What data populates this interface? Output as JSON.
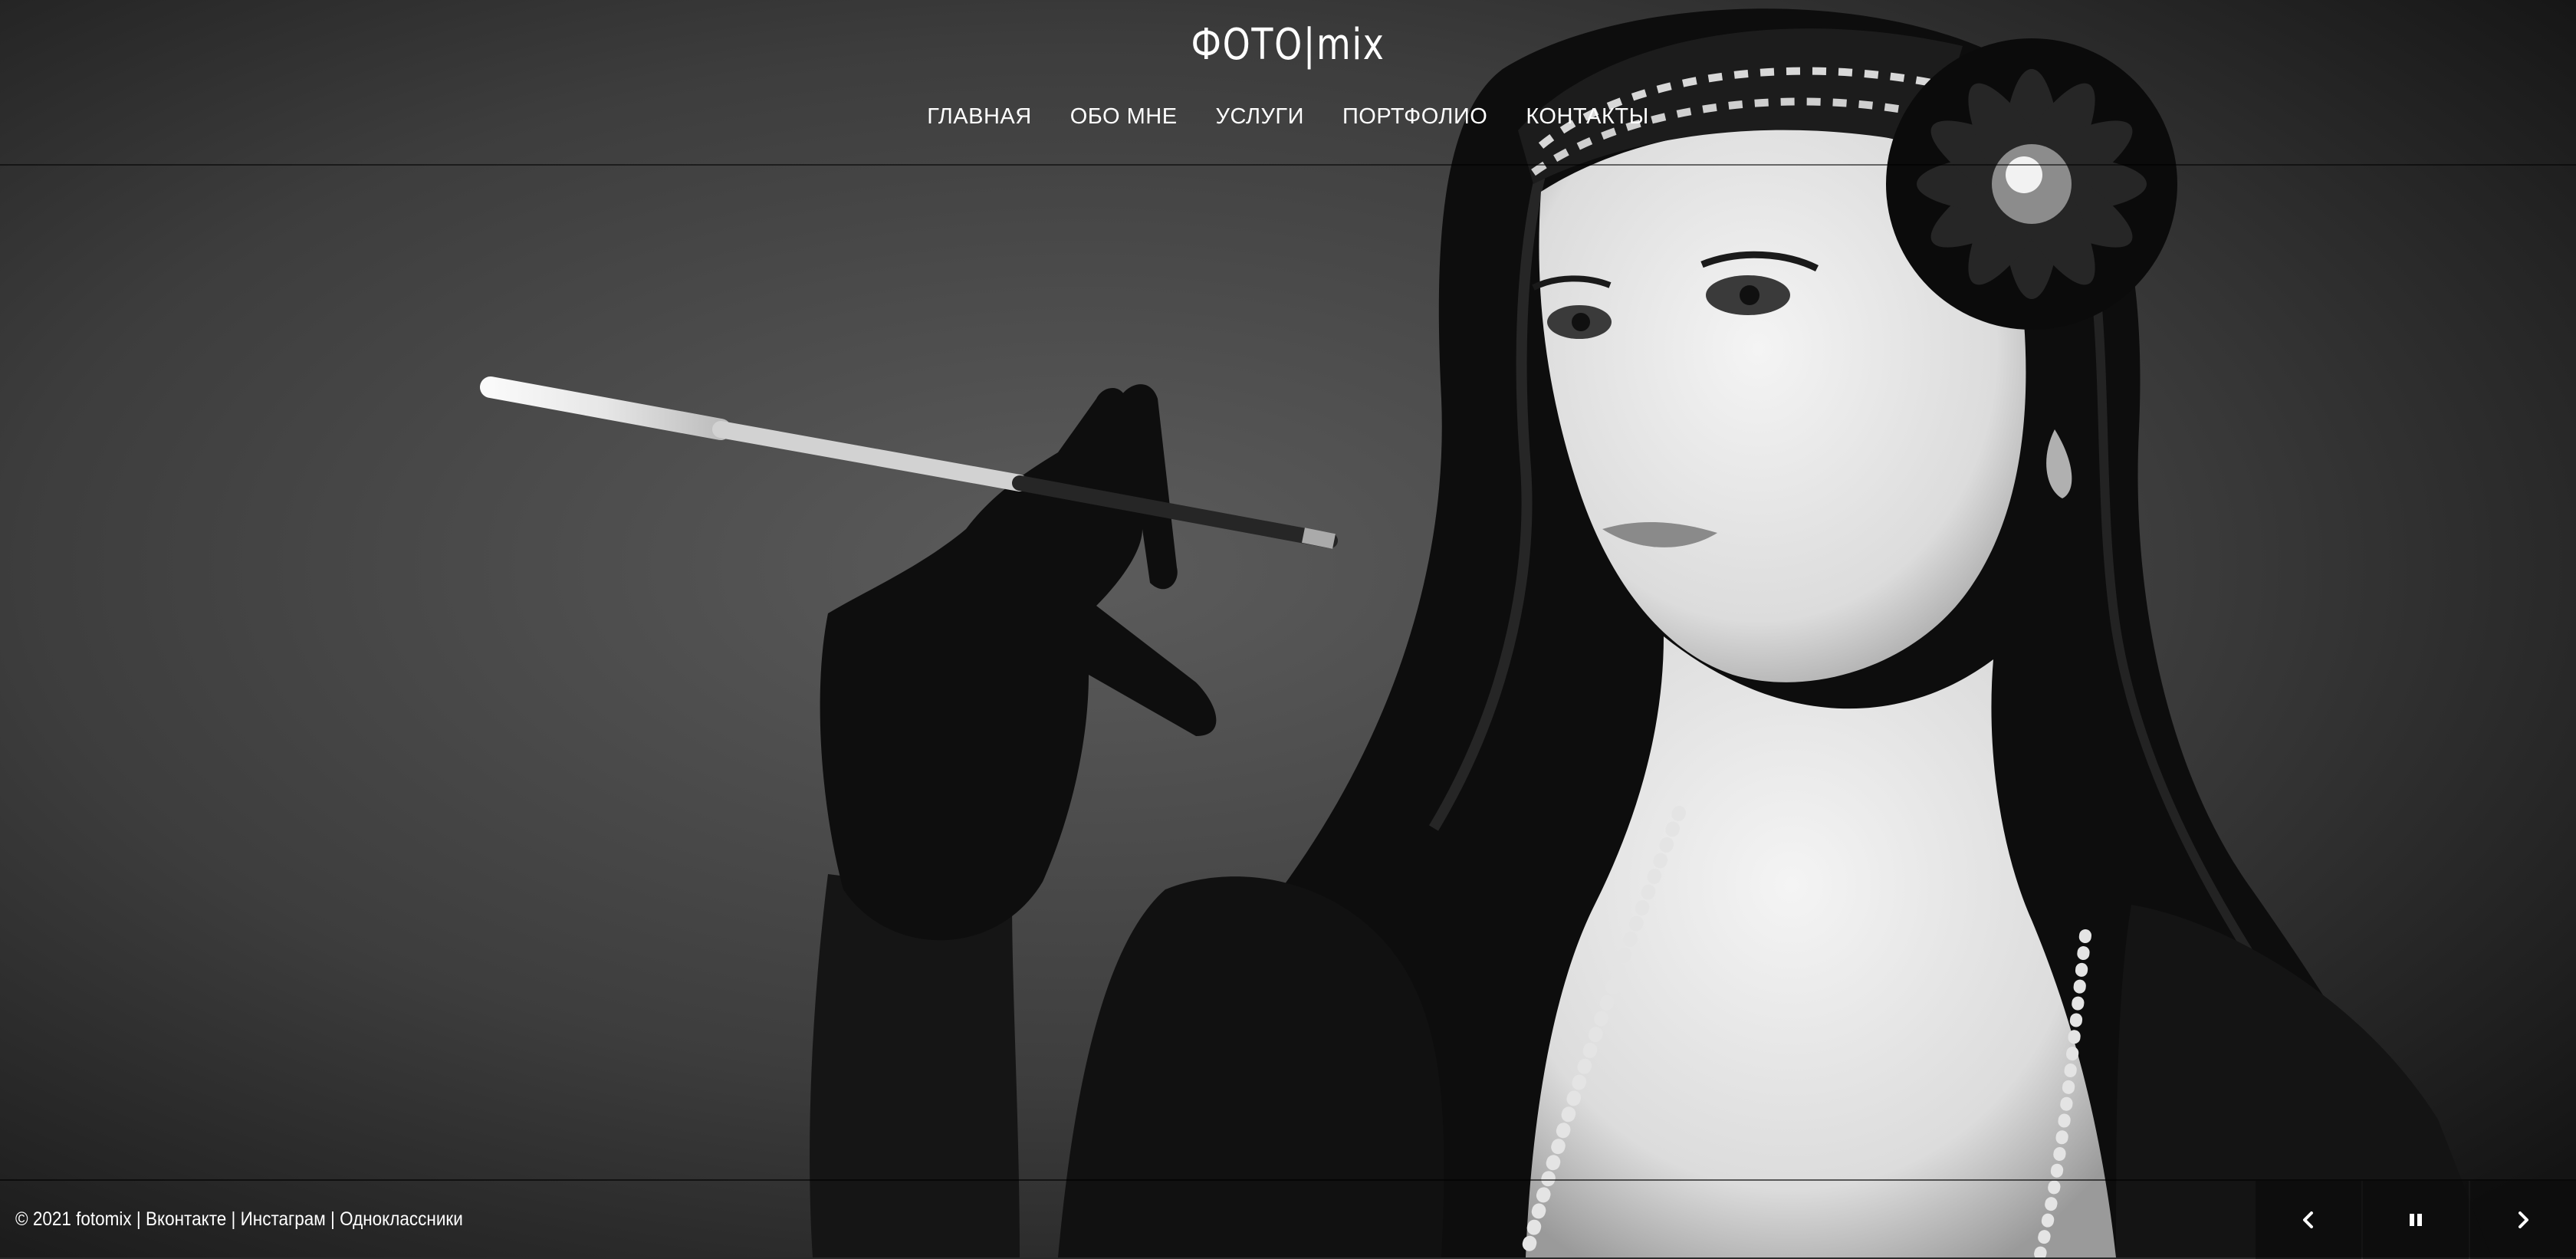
{
  "site": {
    "logo": "ФОТО|mix"
  },
  "nav": {
    "items": [
      {
        "label": "ГЛАВНАЯ"
      },
      {
        "label": "ОБО МНЕ"
      },
      {
        "label": "УСЛУГИ"
      },
      {
        "label": "ПОРТФОЛИО"
      },
      {
        "label": "КОНТАКТЫ"
      }
    ]
  },
  "footer": {
    "copyright": "© 2021 fotomix",
    "separator": " | ",
    "links": [
      {
        "label": "Вконтакте"
      },
      {
        "label": "Инстаграм"
      },
      {
        "label": "Одноклассники"
      }
    ]
  },
  "slider": {
    "controls": [
      {
        "icon": "chevron-left-icon"
      },
      {
        "icon": "pause-icon"
      },
      {
        "icon": "chevron-right-icon"
      }
    ]
  },
  "colors": {
    "text": "#ffffff",
    "overlay": "#000000",
    "background": "#2a2a2a"
  }
}
